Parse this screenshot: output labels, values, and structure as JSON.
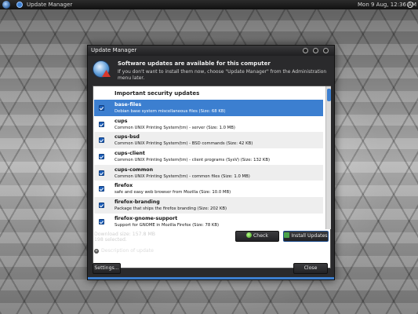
{
  "desktop": {
    "panel": {
      "app_title": "Update Manager",
      "clock": "Mon  9 Aug, 12:36 AM"
    }
  },
  "dialog": {
    "title": "Update Manager",
    "header_title": "Software updates are available for this computer",
    "header_subtitle": "If you don't want to install them now, choose \"Update Manager\" from the Administration menu later.",
    "group_label": "Important security updates",
    "updates": [
      {
        "name": "base-files",
        "description": "Debian base system miscellaneous files (Size: 68 KB)",
        "checked": true,
        "selected": true
      },
      {
        "name": "cups",
        "description": "Common UNIX Printing System(tm) - server (Size: 1.0 MB)",
        "checked": true,
        "selected": false
      },
      {
        "name": "cups-bsd",
        "description": "Common UNIX Printing System(tm) - BSD commands (Size: 42 KB)",
        "checked": true,
        "selected": false
      },
      {
        "name": "cups-client",
        "description": "Common UNIX Printing System(tm) - client programs (SysV) (Size: 132 KB)",
        "checked": true,
        "selected": false
      },
      {
        "name": "cups-common",
        "description": "Common UNIX Printing System(tm) - common files (Size: 1.0 MB)",
        "checked": true,
        "selected": false
      },
      {
        "name": "firefox",
        "description": "safe and easy web browser from Mozilla (Size: 10.0 MB)",
        "checked": true,
        "selected": false
      },
      {
        "name": "firefox-branding",
        "description": "Package that ships the firefox branding (Size: 202 KB)",
        "checked": true,
        "selected": false
      },
      {
        "name": "firefox-gnome-support",
        "description": "Support for GNOME in Mozilla Firefox (Size: 78 KB)",
        "checked": true,
        "selected": false
      }
    ],
    "download_size": "Download size: 157.8 MB",
    "selected_count": "198 selected.",
    "check_label": "Check",
    "install_label": "Install Updates",
    "description_label": "Description of update",
    "settings_label": "Settings...",
    "close_label": "Close",
    "colors": {
      "selection": "#3c7fd0",
      "dialog_bg": "#2a2a2c"
    },
    "icons": {
      "header": "update-manager-icon",
      "check": "reload-icon",
      "install": "install-checkmark-icon"
    }
  }
}
